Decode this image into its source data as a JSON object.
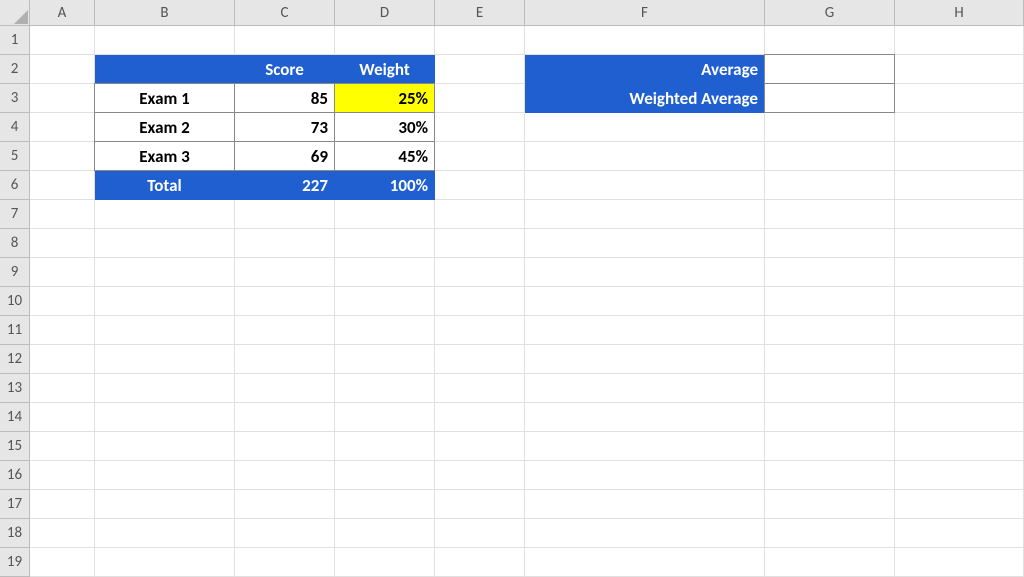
{
  "columns": [
    "A",
    "B",
    "C",
    "D",
    "E",
    "F",
    "G",
    "H"
  ],
  "rows": [
    "1",
    "2",
    "3",
    "4",
    "5",
    "6",
    "7",
    "8",
    "9",
    "10",
    "11",
    "12",
    "13",
    "14",
    "15",
    "16",
    "17",
    "18",
    "19"
  ],
  "table1": {
    "headers": {
      "score": "Score",
      "weight": "Weight"
    },
    "rows": [
      {
        "label": "Exam 1",
        "score": "85",
        "weight": "25%"
      },
      {
        "label": "Exam 2",
        "score": "73",
        "weight": "30%"
      },
      {
        "label": "Exam 3",
        "score": "69",
        "weight": "45%"
      }
    ],
    "total": {
      "label": "Total",
      "score": "227",
      "weight": "100%"
    }
  },
  "table2": {
    "average_label": "Average",
    "weighted_label": "Weighted Average",
    "average_value": "",
    "weighted_value": ""
  },
  "colors": {
    "header_blue": "#1f5fd0",
    "highlight_yellow": "#ffff00"
  }
}
